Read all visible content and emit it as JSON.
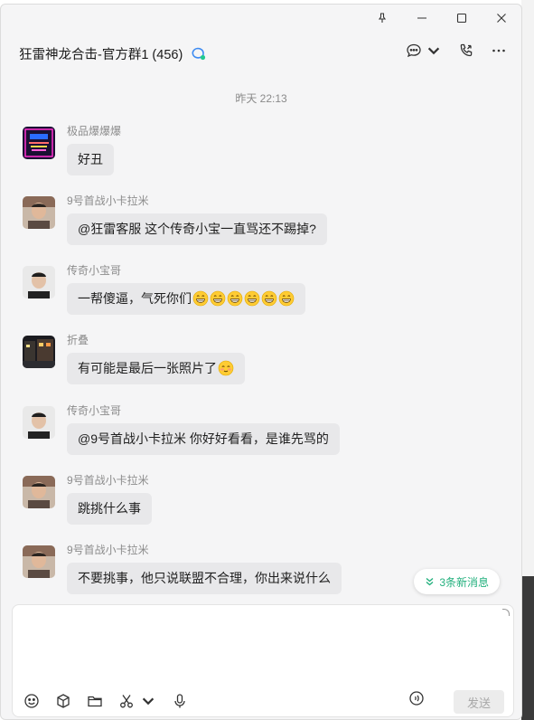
{
  "window": {
    "pin_icon": "pin-icon",
    "minimize_icon": "minimize-icon",
    "maximize_icon": "maximize-icon",
    "close_icon": "close-icon"
  },
  "header": {
    "title": "狂雷神龙合击-官方群1 (456)",
    "group_icon": "group-chat-icon",
    "tools": [
      "chat-bubble-icon",
      "call-icon",
      "more-icon"
    ]
  },
  "timestamp": "昨天 22:13",
  "messages": [
    {
      "sender": "极品爆爆爆",
      "text": "好丑",
      "avatar": "game-poster"
    },
    {
      "sender": "9号首战小卡拉米",
      "text": "@狂雷客服 这个传奇小宝一直骂还不踢掉?",
      "avatar": "man-photo"
    },
    {
      "sender": "传奇小宝哥",
      "text": "一帮傻逼，气死你们",
      "emoji_count": 6,
      "avatar": "man-photo-2"
    },
    {
      "sender": "折叠",
      "text": "有可能是最后一张照片了",
      "emoji_count": 1,
      "avatar": "night-street"
    },
    {
      "sender": "传奇小宝哥",
      "text": "@9号首战小卡拉米 你好好看看，是谁先骂的",
      "avatar": "man-photo-2"
    },
    {
      "sender": "9号首战小卡拉米",
      "text": "跳挑什么事",
      "avatar": "man-photo"
    },
    {
      "sender": "9号首战小卡拉米",
      "text": "不要挑事，他只说联盟不合理，你出来说什么",
      "avatar": "man-photo"
    }
  ],
  "new_messages": "3条新消息",
  "input": {
    "value": "",
    "placeholder": ""
  },
  "input_tools": [
    "emoji-icon",
    "sticker-box-icon",
    "folder-icon",
    "scissors-icon",
    "microphone-icon"
  ],
  "send_label": "发送",
  "colors": {
    "accent": "#22b07d",
    "bubble": "#e8e8ea",
    "background": "#f5f5f6"
  }
}
